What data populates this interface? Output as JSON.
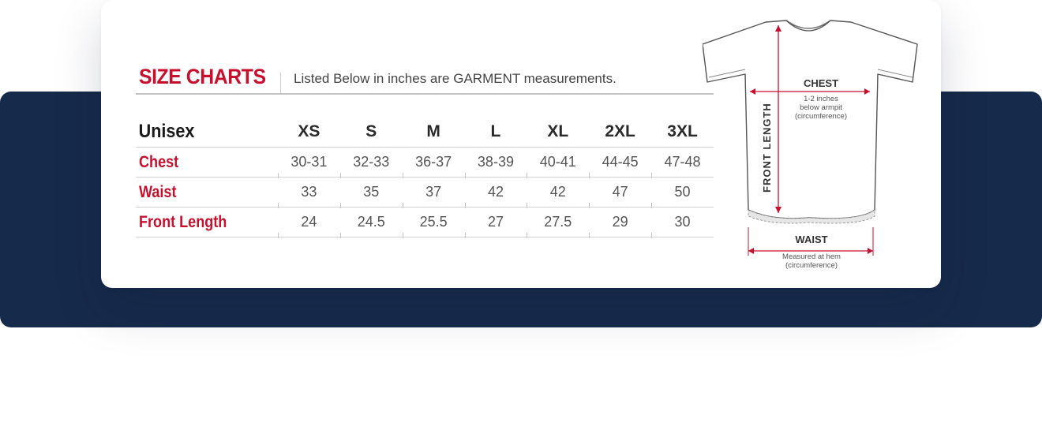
{
  "chart": {
    "title": "SIZE CHARTS",
    "subtitle": "Listed Below in inches are GARMENT measurements.",
    "corner_label": "Unisex",
    "sizes": [
      "XS",
      "S",
      "M",
      "L",
      "XL",
      "2XL",
      "3XL"
    ],
    "rows": [
      {
        "label": "Chest",
        "values": [
          "30-31",
          "32-33",
          "36-37",
          "38-39",
          "40-41",
          "44-45",
          "47-48"
        ]
      },
      {
        "label": "Waist",
        "values": [
          "33",
          "35",
          "37",
          "42",
          "42",
          "47",
          "50"
        ]
      },
      {
        "label": "Front Length",
        "values": [
          "24",
          "24.5",
          "25.5",
          "27",
          "27.5",
          "29",
          "30"
        ]
      }
    ]
  },
  "diagram": {
    "chest_label": "CHEST",
    "chest_note_1": "1-2 inches",
    "chest_note_2": "below armpit",
    "chest_note_3": "(circumference)",
    "front_length_label": "FRONT LENGTH",
    "waist_label": "WAIST",
    "waist_note_1": "Measured at hem",
    "waist_note_2": "(circumference)"
  },
  "colors": {
    "accent_red": "#c8102e",
    "navy_band": "#162a4b"
  }
}
